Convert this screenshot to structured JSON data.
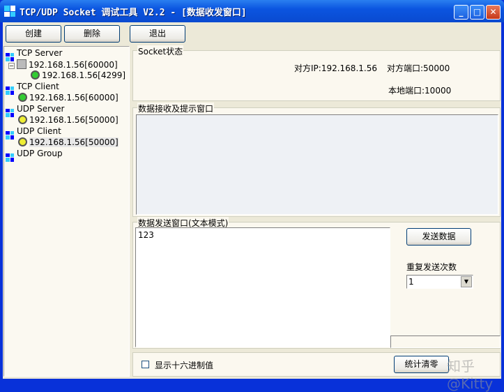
{
  "window": {
    "title": "TCP/UDP Socket 调试工具 V2.2 - [数据收发窗口]",
    "minimize": "_",
    "maximize": "□",
    "close": "✕"
  },
  "toolbar": {
    "create": "创建",
    "delete": "删除",
    "exit": "退出"
  },
  "tree": [
    {
      "label": "TCP Server",
      "type": "category"
    },
    {
      "label": "192.168.1.56[60000]",
      "type": "server"
    },
    {
      "label": "192.168.1.56[4299]",
      "type": "green"
    },
    {
      "label": "TCP Client",
      "type": "category"
    },
    {
      "label": "192.168.1.56[60000]",
      "type": "green"
    },
    {
      "label": "UDP Server",
      "type": "category"
    },
    {
      "label": "192.168.1.56[50000]",
      "type": "yellow"
    },
    {
      "label": "UDP Client",
      "type": "category"
    },
    {
      "label": "192.168.1.56[50000]",
      "type": "yellow",
      "selected": true
    },
    {
      "label": "UDP Group",
      "type": "category"
    }
  ],
  "socket_status": {
    "title": "Socket状态",
    "remote_ip": "对方IP:192.168.1.56",
    "remote_port": "对方端口:50000",
    "local_port": "本地端口:10000"
  },
  "receive": {
    "title": "数据接收及提示窗口"
  },
  "send": {
    "title": "数据发送窗口(文本模式)",
    "text": "123",
    "send_button": "发送数据",
    "repeat_label": "重复发送次数",
    "repeat_value": "1"
  },
  "bottom": {
    "hex_label": "显示十六进制值",
    "hex_checked": false,
    "reset_button": "统计清零"
  },
  "watermark": "知乎 @Kitty"
}
